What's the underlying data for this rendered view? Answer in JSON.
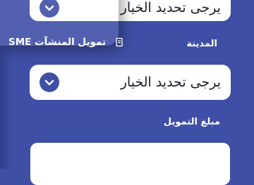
{
  "form": {
    "select_placeholder_top": "يرجى تحديد الخيار",
    "city_label": "المدينة",
    "city_select_placeholder": "يرجى تحديد الخيار",
    "amount_label": "مبلغ التمويل",
    "amount_value": ""
  },
  "drawer": {
    "item_label": "تمويل المنشآت SME",
    "item_icon": "doc-icon"
  },
  "colors": {
    "background": "#3f4fa6",
    "field": "#ffffff",
    "chevron": "#3f4fa6"
  }
}
